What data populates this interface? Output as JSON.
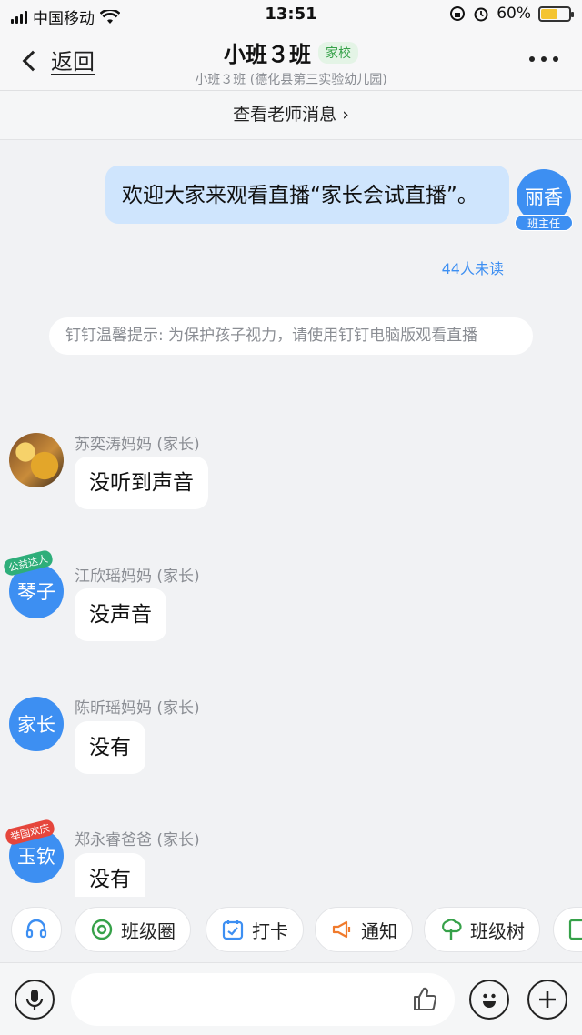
{
  "status": {
    "carrier": "中国移动",
    "time": "13:51",
    "battery": "60%"
  },
  "header": {
    "back_label": "返回",
    "title": "小班３班",
    "tag": "家校",
    "subtitle": "小班３班 (德化县第三实验幼儿园)"
  },
  "teacher_bar": {
    "label": "查看老师消息 ›"
  },
  "own_message": {
    "text": "欢迎大家来观看直播“家长会试直播”。",
    "avatar": "丽香",
    "role": "班主任",
    "unread": "44人未读"
  },
  "tip": {
    "text": "钉钉温馨提示: 为保护孩子视力，请使用钉钉电脑版观看直播"
  },
  "messages": [
    {
      "sender": "苏奕涛妈妈 (家长)",
      "text": "没听到声音",
      "avatar": ""
    },
    {
      "sender": "江欣瑶妈妈 (家长)",
      "text": "没声音",
      "avatar": "琴子",
      "pin": "公益达人"
    },
    {
      "sender": "陈昕瑶妈妈 (家长)",
      "text": "没有",
      "avatar": "家长"
    },
    {
      "sender": "郑永睿爸爸 (家长)",
      "text": "没有",
      "avatar": "玉钦",
      "pin": "举国欢庆"
    }
  ],
  "quick_actions": [
    {
      "label": "",
      "icon": "headset-icon"
    },
    {
      "label": "班级圈",
      "icon": "class-circle-icon"
    },
    {
      "label": "打卡",
      "icon": "calendar-check-icon"
    },
    {
      "label": "通知",
      "icon": "megaphone-icon"
    },
    {
      "label": "班级树",
      "icon": "tree-icon"
    }
  ],
  "colors": {
    "accent": "#3d8ff2",
    "own_bubble": "#cfe5fd",
    "green": "#36a149",
    "orange": "#f07a2c"
  }
}
